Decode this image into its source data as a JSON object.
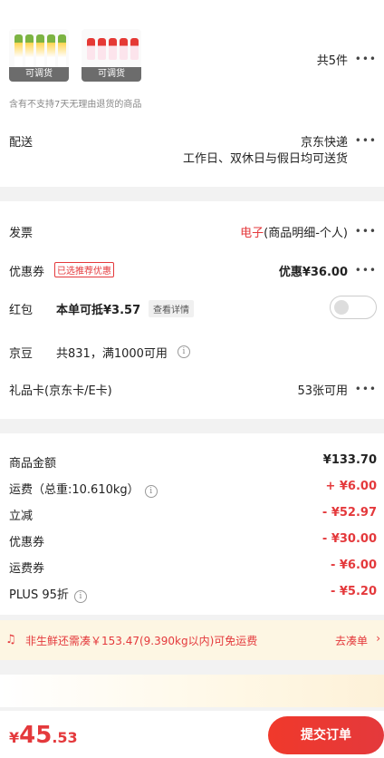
{
  "goods": {
    "items": [
      {
        "tag": "可调货"
      },
      {
        "tag": "可调货"
      }
    ],
    "count_label": "共5件",
    "notice": "含有不支持7天无理由退货的商品"
  },
  "delivery": {
    "label": "配送",
    "carrier": "京东快递",
    "schedule": "工作日、双休日与假日均可送货"
  },
  "invoice": {
    "label": "发票",
    "type": "电子",
    "detail": "(商品明细-个人)"
  },
  "coupon": {
    "label": "优惠券",
    "badge": "已选推荐优惠",
    "value": "优惠¥36.00"
  },
  "redpacket": {
    "label": "红包",
    "text": "本单可抵¥3.57",
    "link": "查看详情"
  },
  "jingdou": {
    "label": "京豆",
    "text": "共831，满1000可用"
  },
  "giftcard": {
    "label": "礼品卡(京东卡/E卡)",
    "value": "53张可用"
  },
  "summary": [
    {
      "label": "商品金额",
      "value": "¥133.70"
    },
    {
      "label": "运费（总重:10.610kg）",
      "value": "+ ¥6.00"
    },
    {
      "label": "立减",
      "value": "- ¥52.97"
    },
    {
      "label": "优惠券",
      "value": "- ¥30.00"
    },
    {
      "label": "运费券",
      "value": "- ¥6.00"
    },
    {
      "label": "PLUS 95折",
      "value": "- ¥5.20"
    }
  ],
  "banner": {
    "text": "非生鲜还需凑￥153.47(9.390kg以内)可免运费",
    "action": "去凑单"
  },
  "footer": {
    "currency": "¥",
    "price_int": "45",
    "price_dec": ".53",
    "submit": "提交订单"
  },
  "colors": {
    "accent": "#e4393c",
    "banner_bg": "#fdf6e3"
  }
}
